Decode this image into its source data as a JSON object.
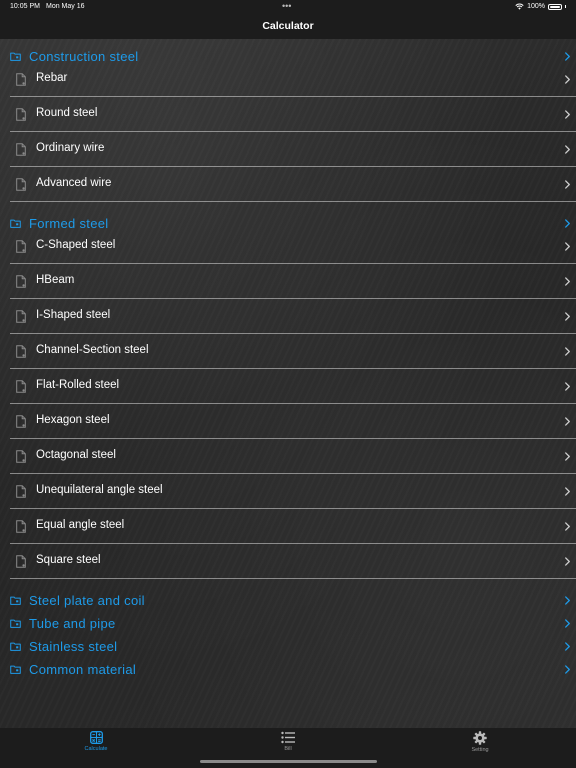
{
  "status": {
    "time": "10:05 PM",
    "date": "Mon May 16",
    "battery": "100%"
  },
  "nav": {
    "title": "Calculator"
  },
  "sections": [
    {
      "title": "Construction steel",
      "items": [
        "Rebar",
        "Round steel",
        "Ordinary wire",
        "Advanced wire"
      ]
    },
    {
      "title": "Formed steel",
      "items": [
        "C-Shaped steel",
        "HBeam",
        "I-Shaped steel",
        "Channel-Section steel",
        "Flat-Rolled steel",
        "Hexagon steel",
        "Octagonal steel",
        "Unequilateral angle steel",
        "Equal angle steel",
        "Square steel"
      ]
    },
    {
      "title": "Steel plate and coil",
      "items": []
    },
    {
      "title": "Tube and pipe",
      "items": []
    },
    {
      "title": "Stainless steel",
      "items": []
    },
    {
      "title": "Common material",
      "items": []
    }
  ],
  "tabs": [
    {
      "label": "Calculate",
      "icon": "calculator-icon",
      "active": true
    },
    {
      "label": "Bill",
      "icon": "list-icon",
      "active": false
    },
    {
      "label": "Setting",
      "icon": "gear-icon",
      "active": false
    }
  ],
  "colors": {
    "accent": "#1e9be9",
    "bar": "#1c1c1c"
  }
}
